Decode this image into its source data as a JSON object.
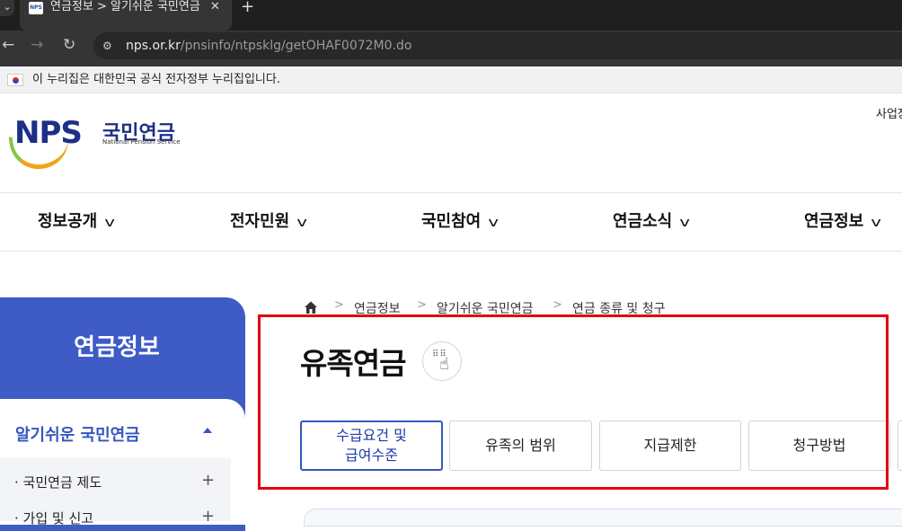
{
  "browser": {
    "tab_title": "연금정보 > 알기쉬운 국민연금",
    "favicon_text": "NPS",
    "url_host": "nps.or.kr",
    "url_path": "/pnsinfo/ntpsklg/getOHAF0072M0.do",
    "gov_notice": "이 누리집은 대한민국 공식 전자정부 누리집입니다."
  },
  "header": {
    "logo_text": "NPS",
    "logo_korean": "국민연금",
    "logo_english": "National Pension Service",
    "top_right_link": "사업장",
    "brand_colors": {
      "navy": "#1d2f86",
      "orange": "#f1a31b",
      "green": "#8bc34a"
    }
  },
  "gnb": {
    "items": [
      "정보공개",
      "전자민원",
      "국민참여",
      "연금소식",
      "연금정보"
    ]
  },
  "sidebar": {
    "title": "연금정보",
    "section": "알기쉬운 국민연금",
    "sub_items": [
      {
        "label": "국민연금 제도"
      },
      {
        "label": "가입 및 신고"
      }
    ],
    "accent": "#3e5bc6"
  },
  "breadcrumb": {
    "items": [
      "연금정보",
      "알기쉬운 국민연금",
      "연금 종류 및 청구"
    ]
  },
  "main": {
    "title": "유족연금",
    "tabs": [
      {
        "label": "수급요건 및\n급여수준",
        "active": true
      },
      {
        "label": "유족의 범위",
        "active": false
      },
      {
        "label": "지급제한",
        "active": false
      },
      {
        "label": "청구방법",
        "active": false
      }
    ]
  }
}
